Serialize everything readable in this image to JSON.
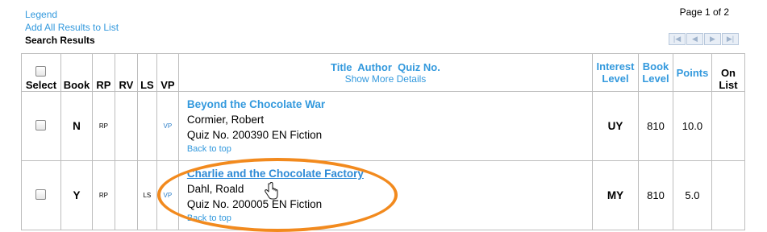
{
  "top_links": {
    "legend": "Legend",
    "add_all": "Add All Results to List",
    "search_results": "Search Results"
  },
  "page_info": "Page 1 of 2",
  "pager_icons": [
    "first-page-icon",
    "prev-page-icon",
    "next-page-icon",
    "last-page-icon"
  ],
  "table": {
    "headers": {
      "select": "Select",
      "book": "Book",
      "rp": "RP",
      "rv": "RV",
      "ls": "LS",
      "vp": "VP",
      "title": "Title  Author  Quiz No.",
      "show_more": "Show More Details",
      "interest_line1": "Interest",
      "interest_line2": "Level",
      "book_level_line1": "Book",
      "book_level_line2": "Level",
      "points": "Points",
      "on_list_line1": "On",
      "on_list_line2": "List"
    },
    "rows": [
      {
        "book": "N",
        "rp": "RP",
        "rv": "",
        "ls": "",
        "vp": "VP",
        "title": "Beyond the Chocolate War",
        "author": "Cormier, Robert",
        "quiz": "Quiz No. 200390 EN Fiction",
        "back": "Back to top",
        "interest": "UY",
        "book_level": "810",
        "points": "10.0",
        "on_list": ""
      },
      {
        "book": "Y",
        "rp": "RP",
        "rv": "",
        "ls": "LS",
        "vp": "VP",
        "title": "Charlie and the Chocolate Factory",
        "author": "Dahl, Roald",
        "quiz": "Quiz No. 200005 EN Fiction",
        "back": "Back to top",
        "interest": "MY",
        "book_level": "810",
        "points": "5.0",
        "on_list": ""
      }
    ]
  },
  "colors": {
    "link": "#3399dd",
    "highlight": "#f28a1e"
  }
}
